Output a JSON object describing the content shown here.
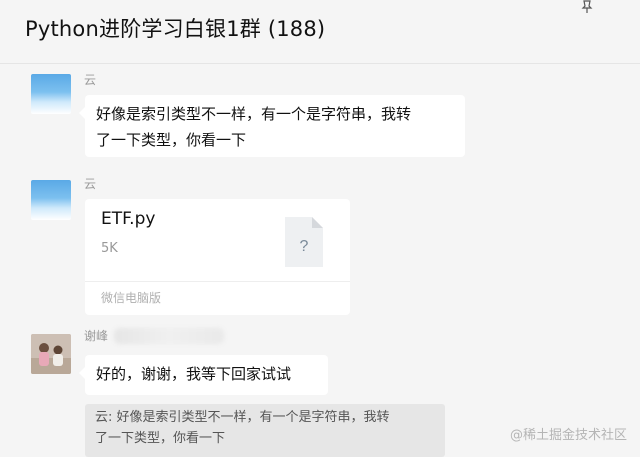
{
  "header": {
    "title": "Python进阶学习白银1群 (188)"
  },
  "messages": [
    {
      "sender": "云",
      "text_line1": "好像是索引类型不一样，有一个是字符串，我转",
      "text_line2": "了一下类型，你看一下"
    },
    {
      "sender": "云",
      "file": {
        "name": "ETF.py",
        "size": "5K",
        "icon_glyph": "?",
        "source": "微信电脑版"
      }
    },
    {
      "sender": "谢峰",
      "text": "好的，谢谢，我等下回家试试",
      "quote_line1": "云: 好像是索引类型不一样，有一个是字符串，我转",
      "quote_line2": "了一下类型，你看一下"
    }
  ],
  "watermark": "@稀土掘金技术社区",
  "colors": {
    "background": "#f5f5f5",
    "bubble": "#ffffff",
    "quote_bg": "#e6e6e6",
    "sender_text": "#9a9a9a"
  }
}
